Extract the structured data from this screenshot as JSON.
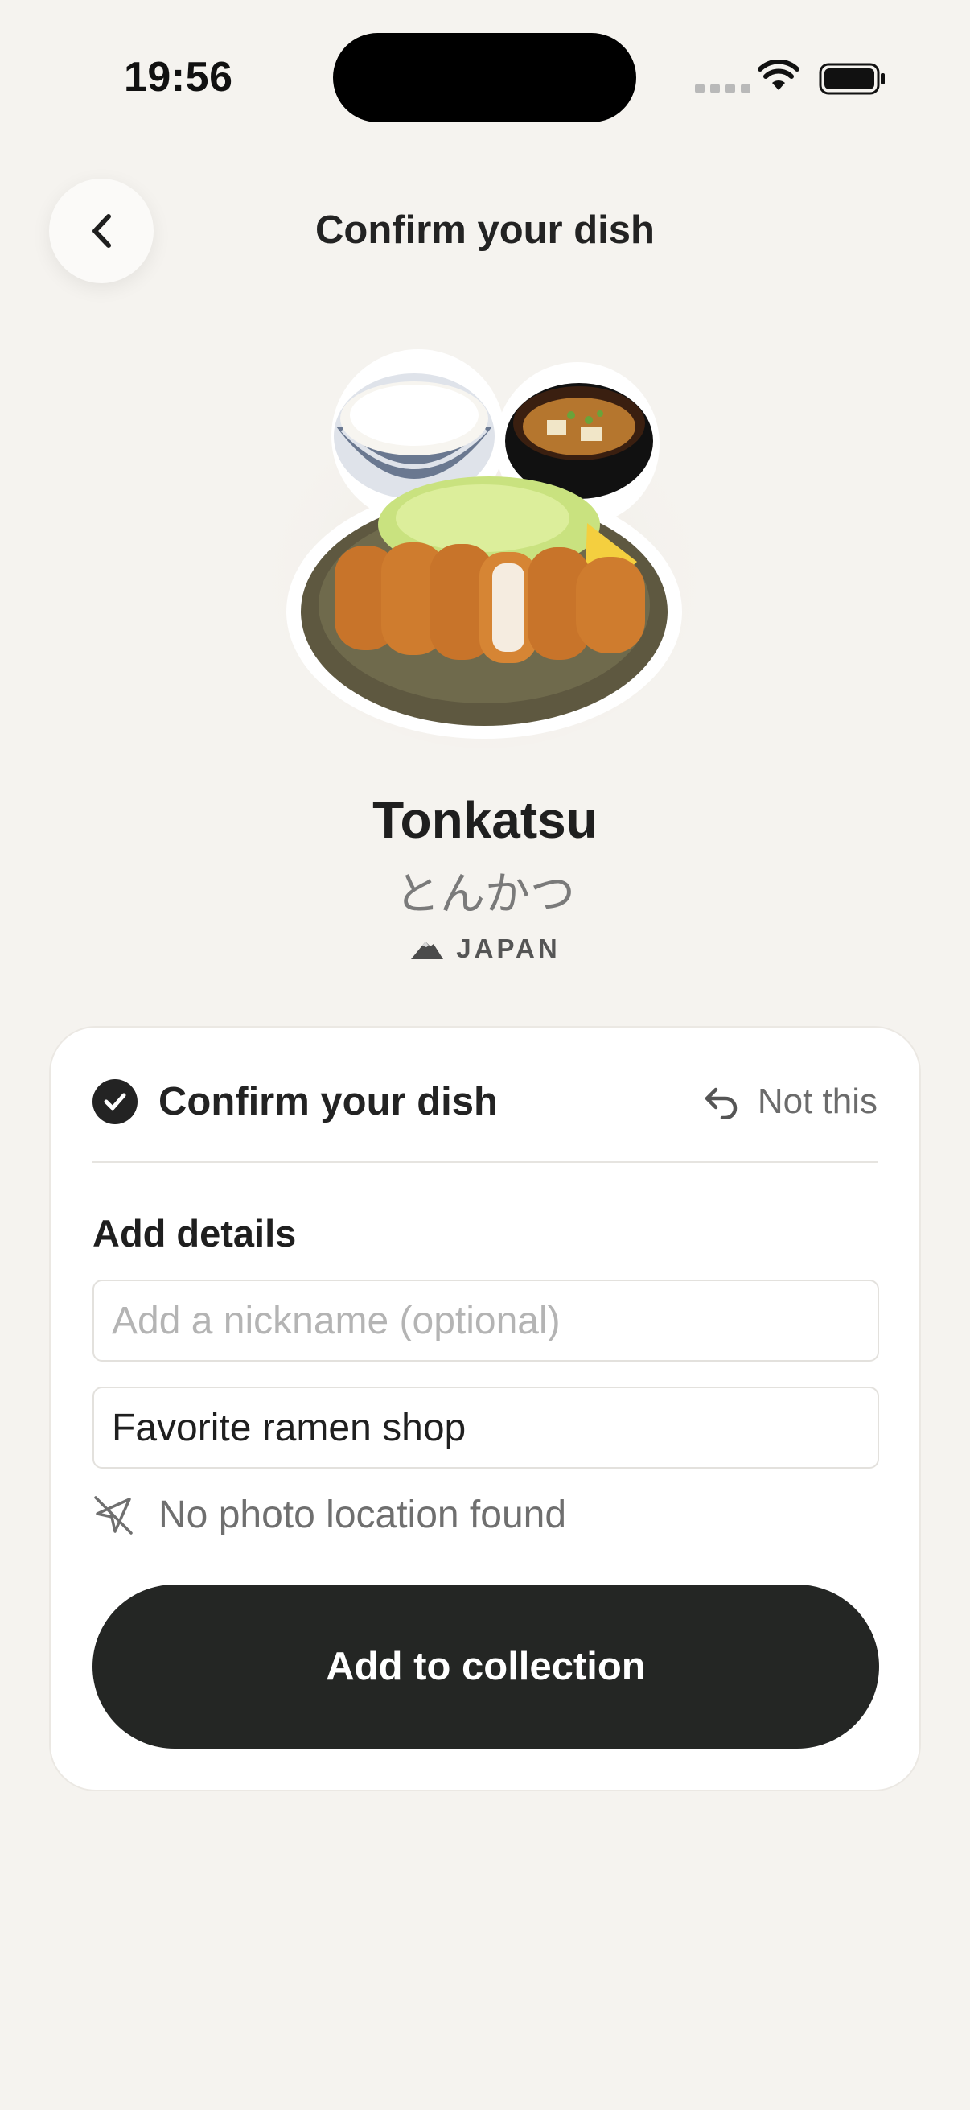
{
  "status_bar": {
    "time": "19:56"
  },
  "header": {
    "title": "Confirm your dish"
  },
  "dish": {
    "name": "Tonkatsu",
    "native_name": "とんかつ",
    "origin": "JAPAN"
  },
  "card": {
    "confirm_label": "Confirm your dish",
    "not_this_label": "Not this",
    "details_heading": "Add details",
    "nickname_placeholder": "Add a nickname (optional)",
    "nickname_value": "",
    "place_value": "Favorite ramen shop",
    "location_status": "No photo location found",
    "add_button_label": "Add to collection"
  },
  "colors": {
    "background": "#f5f3ef",
    "card": "#ffffff",
    "primary_button": "#242624",
    "muted_text": "#6f6f6f"
  },
  "icons": {
    "back": "chevron-left-icon",
    "confirm": "check-circle-icon",
    "not_this": "undo-arrow-icon",
    "location": "location-off-icon",
    "origin": "mountain-icon"
  }
}
